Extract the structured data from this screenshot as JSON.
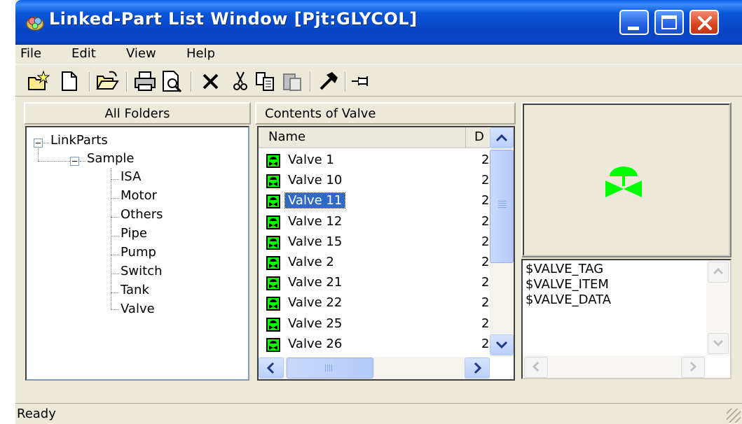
{
  "window": {
    "title": "Linked-Part List Window [Pjt:GLYCOL]"
  },
  "menu": [
    "File",
    "Edit",
    "View",
    "Help"
  ],
  "toolbar": {
    "icons": [
      "new-folder-icon",
      "new-document-icon",
      "open-folder-icon",
      "print-icon",
      "print-preview-icon",
      "delete-icon",
      "cut-icon",
      "copy-icon",
      "paste-icon",
      "hammer-icon",
      "pin-icon"
    ]
  },
  "folders": {
    "header": "All Folders",
    "root": "LinkParts",
    "child": "Sample",
    "items": [
      "ISA",
      "Motor",
      "Others",
      "Pipe",
      "Pump",
      "Switch",
      "Tank",
      "Valve"
    ]
  },
  "contents": {
    "header": "Contents of Valve",
    "column_name": "Name",
    "column_second": "D",
    "rows": [
      "Valve 1",
      "Valve 10",
      "Valve 11",
      "Valve 12",
      "Valve 15",
      "Valve 2",
      "Valve 21",
      "Valve 22",
      "Valve 25",
      "Valve 26"
    ],
    "selected": "Valve 11",
    "row_suffix": "2"
  },
  "properties": {
    "lines": [
      "$VALVE_TAG",
      "$VALVE_ITEM",
      "$VALVE_DATA"
    ]
  },
  "status": {
    "text": "Ready"
  },
  "colors": {
    "titlebar": "#0a55d8",
    "selection": "#316ac5",
    "valve_symbol": "#00ff00"
  }
}
